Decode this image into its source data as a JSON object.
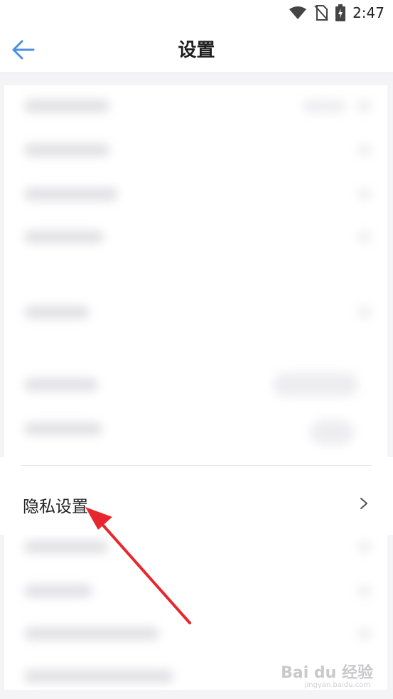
{
  "status_bar": {
    "time": "2:47"
  },
  "header": {
    "title": "设置"
  },
  "privacy_item": {
    "label": "隐私设置"
  },
  "watermark": {
    "brand": "Bai du 经验",
    "sub": "jingyan.baidu.com"
  },
  "colors": {
    "accent": "#4a90e2",
    "annotation_arrow": "#e8262d"
  }
}
